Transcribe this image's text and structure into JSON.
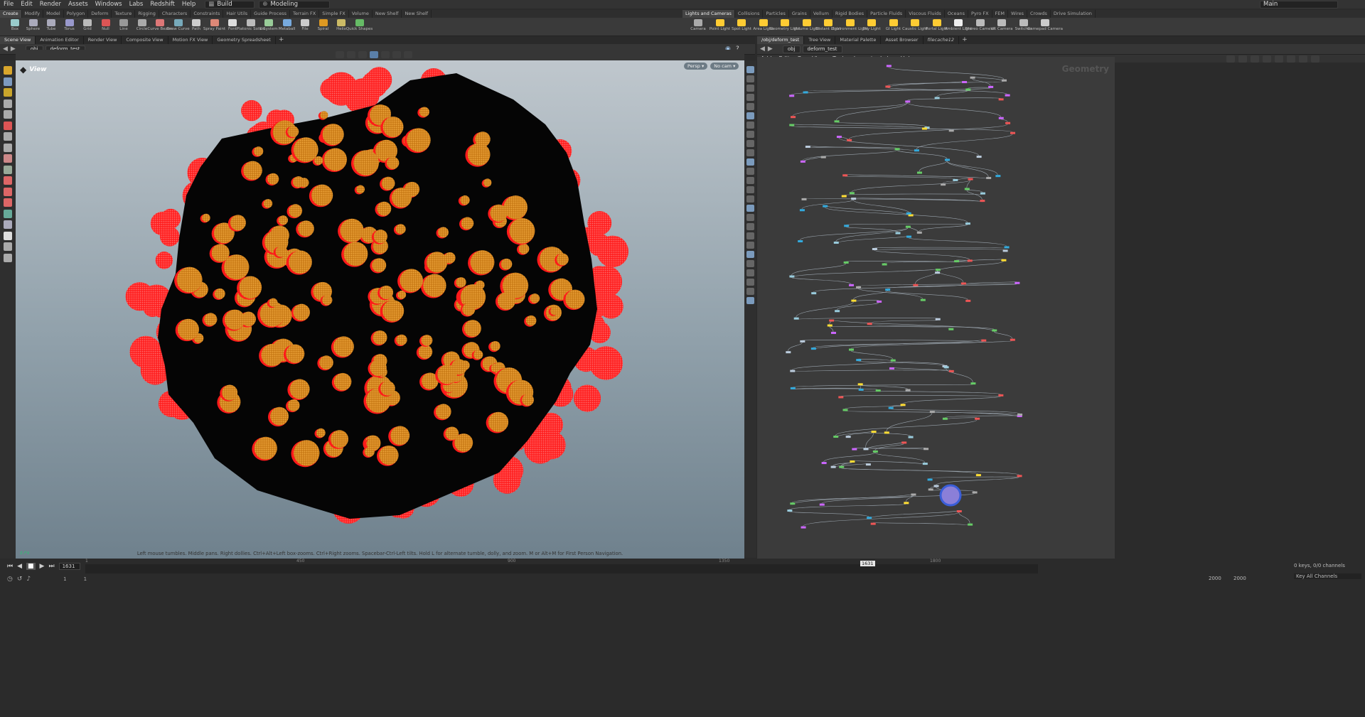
{
  "menubar": {
    "items": [
      "File",
      "Edit",
      "Render",
      "Assets",
      "Windows",
      "Labs",
      "Redshift",
      "Help"
    ],
    "build": "Build",
    "desktop": "Modeling",
    "main": "Main"
  },
  "shelf_tabs_left": [
    "Create",
    "Modify",
    "Model",
    "Polygon",
    "Deform",
    "Texture",
    "Rigging",
    "Characters",
    "Constraints",
    "Hair Utils",
    "Guide Process",
    "Terrain FX",
    "Simple FX",
    "Volume",
    "New Shelf",
    "New Shelf"
  ],
  "shelf_tabs_right": [
    "Lights and Cameras",
    "Collisions",
    "Particles",
    "Grains",
    "Vellum",
    "Rigid Bodies",
    "Particle Fluids",
    "Viscous Fluids",
    "Oceans",
    "Pyro FX",
    "FEM",
    "Wires",
    "Crowds",
    "Drive Simulation"
  ],
  "tools_left": [
    "Box",
    "Sphere",
    "Tube",
    "Torus",
    "Grid",
    "Null",
    "Line",
    "Circle",
    "Curve Bezier",
    "Draw Curve",
    "Path",
    "Spray Paint",
    "Font",
    "Platonic Solids",
    "L-System",
    "Metaball",
    "File",
    "Spiral",
    "Helix",
    "Quick Shapes"
  ],
  "tools_right": [
    "Camera",
    "Point Light",
    "Spot Light",
    "Area Light",
    "Geometry Light",
    "Volume Light",
    "Distant Light",
    "Environment Light",
    "Sky Light",
    "GI Light",
    "Caustic Light",
    "Portal Light",
    "Ambient Light",
    "Stereo Camera",
    "VR Camera",
    "Switcher",
    "Gamepad Camera"
  ],
  "left_pane_tabs": [
    "Scene View",
    "Animation Editor",
    "Render View",
    "Composite View",
    "Motion FX View",
    "Geometry Spreadsheet"
  ],
  "right_pane_tabs": [
    "/obj/deform_test",
    "Tree View",
    "Material Palette",
    "Asset Browser",
    "filecache12"
  ],
  "left_path": {
    "root": "obj",
    "node": "deform_test"
  },
  "right_path": {
    "root": "obj",
    "node": "deform_test"
  },
  "network_menu": [
    "Add",
    "Edit",
    "Go",
    "View",
    "Tools",
    "Layout",
    "Labs",
    "Help"
  ],
  "network_label": "Geometry",
  "viewport": {
    "title": "View",
    "persp": "Persp",
    "cam": "No cam",
    "hint": "Left mouse tumbles. Middle pans. Right dollies. Ctrl+Alt+Left box-zooms. Ctrl+Right zooms. Spacebar-Ctrl-Left tilts. Hold L for alternate tumble, dolly, and zoom. M or Alt+M for First Person Navigation."
  },
  "timeline": {
    "frame": "1631",
    "ticks": [
      "1",
      "450",
      "900",
      "1350",
      "1800"
    ],
    "marker": "1631",
    "start": "1",
    "start2": "1",
    "end": "2000",
    "end2": "2000",
    "keys": "0 keys, 0/0 channels",
    "keyall": "Key All Channels"
  },
  "colors": {
    "accent_orange": "#d48a1e",
    "blob_red": "#ff1a1a"
  }
}
